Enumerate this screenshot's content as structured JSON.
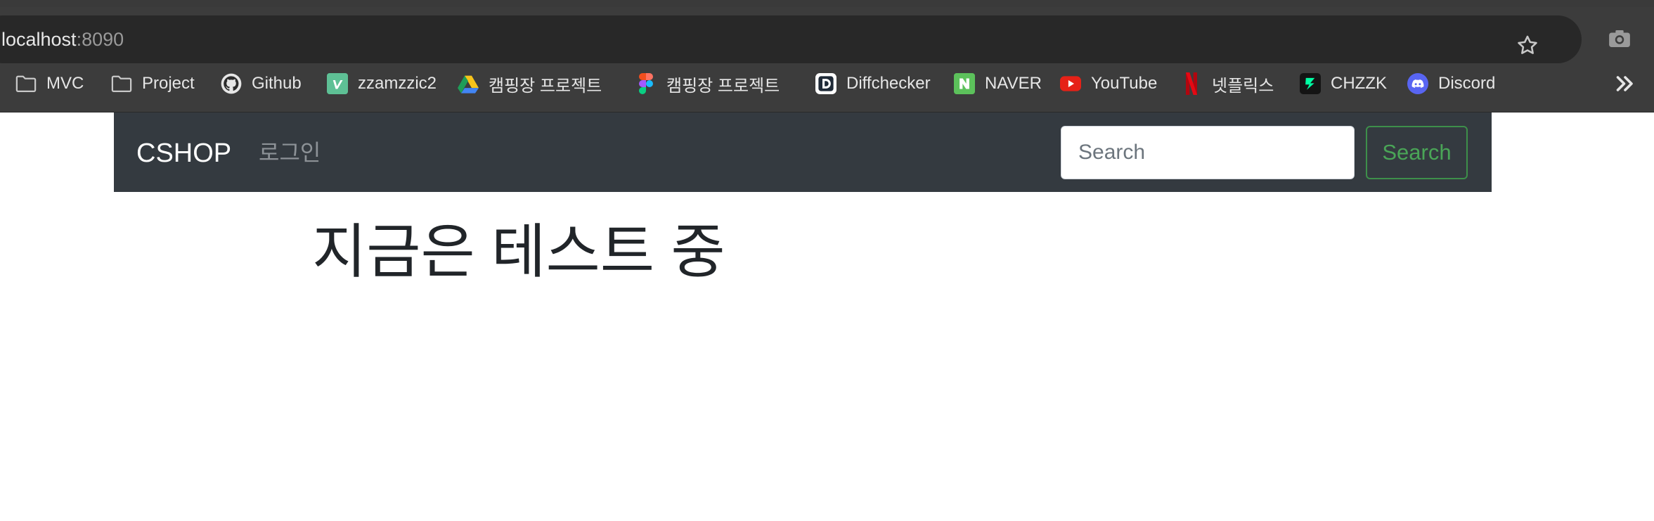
{
  "browser": {
    "url_host": "localhost",
    "url_port": ":8090",
    "bookmarks": [
      {
        "label": "MVC",
        "icon": "folder-icon"
      },
      {
        "label": "Project",
        "icon": "folder-icon"
      },
      {
        "label": "Github",
        "icon": "github-icon"
      },
      {
        "label": "zzamzzic2",
        "icon": "vimeo-icon"
      },
      {
        "label": "캠핑장 프로젝트",
        "icon": "google-drive-icon"
      },
      {
        "label": "캠핑장 프로젝트",
        "icon": "figma-icon"
      },
      {
        "label": "Diffchecker",
        "icon": "diffchecker-icon"
      },
      {
        "label": "NAVER",
        "icon": "naver-icon"
      },
      {
        "label": "YouTube",
        "icon": "youtube-icon"
      },
      {
        "label": "넷플릭스",
        "icon": "netflix-icon"
      },
      {
        "label": "CHZZK",
        "icon": "chzzk-icon"
      },
      {
        "label": "Discord",
        "icon": "discord-icon"
      }
    ]
  },
  "navbar": {
    "brand": "CSHOP",
    "login": "로그인",
    "search_placeholder": "Search",
    "search_button": "Search"
  },
  "main": {
    "heading": "지금은 테스트 중"
  },
  "colors": {
    "chrome_bg": "#3c3c3c",
    "omnibox_bg": "#282828",
    "navbar_bg": "#343a40",
    "search_button_accent": "#4aa557"
  }
}
